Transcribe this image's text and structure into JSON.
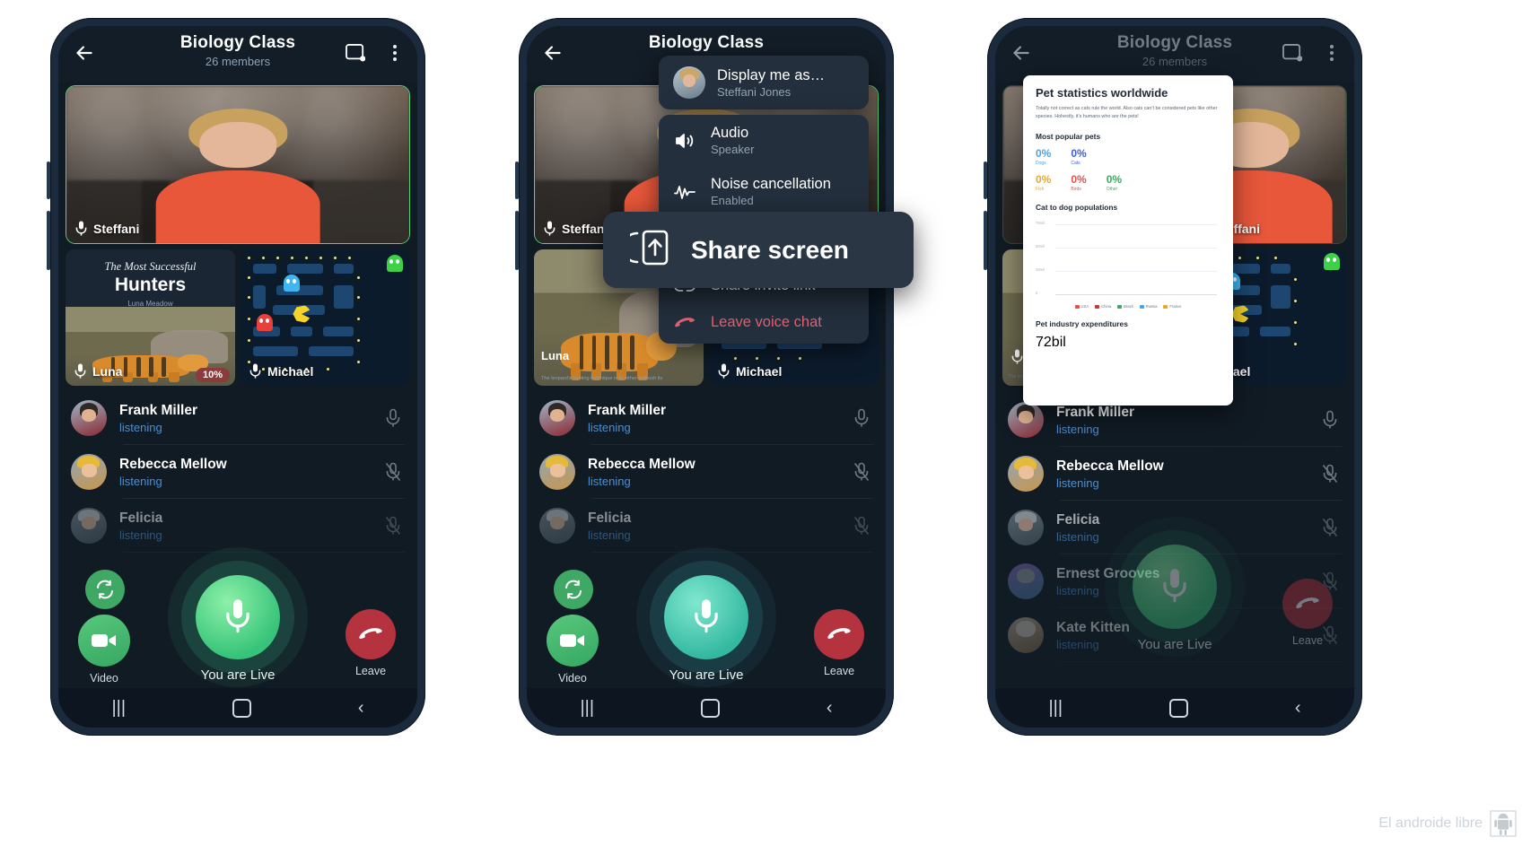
{
  "app": {
    "title": "Biology Class",
    "members": "26 members",
    "back_icon": "back-arrow-icon",
    "pip_icon": "picture-in-picture-icon",
    "overflow_icon": "overflow-menu-icon"
  },
  "video": {
    "main_speaker": "Steffani",
    "tiles": [
      {
        "name": "Luna",
        "kind": "presentation",
        "slide_overline": "The Most Successful",
        "slide_title": "Hunters",
        "slide_author": "Luna Meadow",
        "badge": "10%",
        "caption": "The leopard's hunting technique is to either ambush its"
      },
      {
        "name": "Michael",
        "kind": "game"
      }
    ]
  },
  "participants": [
    {
      "name": "Frank Miller",
      "status": "listening",
      "muted": false
    },
    {
      "name": "Rebecca Mellow",
      "status": "listening",
      "muted": true
    },
    {
      "name": "Felicia",
      "status": "listening",
      "muted": true
    },
    {
      "name": "Ernest Grooves",
      "status": "listening",
      "muted": true
    },
    {
      "name": "Kate Kitten",
      "status": "listening",
      "muted": true
    }
  ],
  "controls": {
    "flip_icon": "camera-flip-icon",
    "video_label": "Video",
    "video_icon": "video-camera-icon",
    "mic_icon": "microphone-icon",
    "live_label": "You are Live",
    "leave_label": "Leave",
    "leave_icon": "hang-up-icon"
  },
  "navbar": {
    "recents_icon": "recents-icon",
    "home_icon": "home-icon",
    "back_icon": "nav-back-icon"
  },
  "menu": {
    "display_as": {
      "label": "Display me as…",
      "value": "Steffani Jones",
      "avatar": "user-avatar"
    },
    "items": [
      {
        "label": "Audio",
        "value": "Speaker",
        "icon": "speaker-icon",
        "danger": false
      },
      {
        "label": "Noise cancellation",
        "value": "Enabled",
        "icon": "waveform-icon",
        "danger": false
      },
      {
        "label": "Share invite link",
        "value": "",
        "icon": "link-icon",
        "danger": false
      },
      {
        "label": "Leave voice chat",
        "value": "",
        "icon": "hang-up-icon",
        "danger": true
      }
    ],
    "pressed_item": {
      "label": "Share screen",
      "icon": "share-screen-icon"
    }
  },
  "shared_doc": {
    "title": "Pet statistics worldwide",
    "paragraph": "Totally not correct as cats rule the world. Also cats can't be considered pets like other species. Hohestly, it's humans who are the pets!",
    "section_popular": "Most popular pets",
    "stats": [
      {
        "label": "Dogs",
        "value": "0%",
        "color": "#4aa3e8"
      },
      {
        "label": "Cats",
        "value": "0%",
        "color": "#3b5fd4"
      },
      {
        "label": "Fish",
        "value": "0%",
        "color": "#e8a72a"
      },
      {
        "label": "Birds",
        "value": "0%",
        "color": "#e0524c"
      },
      {
        "label": "Other",
        "value": "0%",
        "color": "#3fa860"
      }
    ],
    "section_cat_dog": "Cat to dog populations",
    "y_ticks": [
      "75mil",
      "50mil",
      "25mil",
      "0"
    ],
    "legend": [
      {
        "label": "USA",
        "color": "#e0524c"
      },
      {
        "label": "China",
        "color": "#c33a36"
      },
      {
        "label": "Brazil",
        "color": "#3fa860"
      },
      {
        "label": "Russia",
        "color": "#4aa3e8"
      },
      {
        "label": "France",
        "color": "#e8a72a"
      }
    ],
    "section_expenditures": "Pet industry expenditures",
    "exp_tick": "72bil"
  },
  "watermark": {
    "text": "El androide libre",
    "icon": "android-robot-icon"
  },
  "theme": {
    "accent_green": "#3fc47d",
    "danger_red": "#b5323f",
    "link_blue": "#4e8fd0",
    "panel": "#131d27",
    "menu_bg": "#232f3d"
  }
}
